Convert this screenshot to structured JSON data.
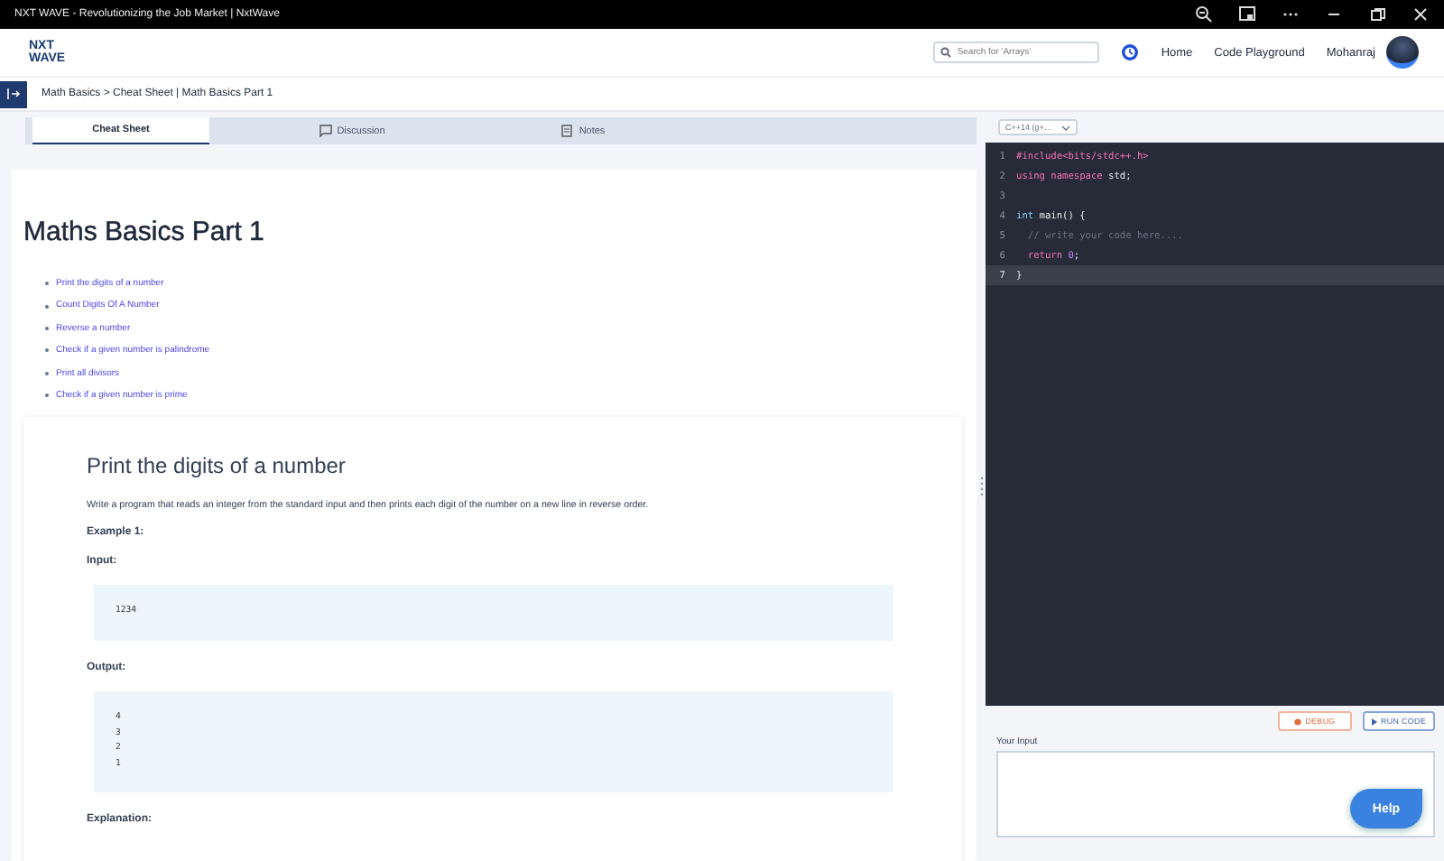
{
  "window": {
    "title": "NXT WAVE - Revolutionizing the Job Market | NxtWave"
  },
  "header": {
    "logo_lines": [
      "NXT",
      "WAVE"
    ],
    "search": {
      "placeholder": "Search for 'Arrays'"
    },
    "nav": [
      "Home",
      "Code Playground"
    ],
    "user_name": "Mohanraj"
  },
  "breadcrumb": "Math Basics > Cheat Sheet | Math Basics Part 1",
  "tabs": [
    {
      "label": "Cheat Sheet",
      "selected": true,
      "kind": "plain"
    },
    {
      "label": "Discussion",
      "selected": false,
      "kind": "chat"
    },
    {
      "label": "Notes",
      "selected": false,
      "kind": "notes"
    }
  ],
  "article": {
    "title": "Maths Basics Part 1",
    "toc": [
      "Print the digits of a number",
      "Count Digits Of A Number",
      "Reverse a number",
      "Check if a given number is palindrome",
      "Print all divisors",
      "Check if a given number is prime"
    ],
    "section": {
      "heading": "Print the digits of a number",
      "blocks": [
        {
          "kind": "paragraph",
          "text": "Write a program that reads an integer from the standard input and then prints each digit of the number on a new line in reverse order."
        },
        {
          "kind": "label",
          "text": "Example 1:"
        },
        {
          "kind": "label",
          "text": "Input:"
        },
        {
          "kind": "code",
          "lines": [
            "1234"
          ]
        },
        {
          "kind": "label",
          "text": "Output:"
        },
        {
          "kind": "code",
          "lines": [
            "4",
            "3",
            "2",
            "1"
          ]
        },
        {
          "kind": "label",
          "text": "Explanation:"
        }
      ]
    }
  },
  "editor": {
    "language": "C++14 (g+…",
    "lines": [
      {
        "number": "1",
        "selected": false,
        "tokens": [
          {
            "text": "#include<bits/stdc++.h>",
            "kind": "keyword"
          }
        ]
      },
      {
        "number": "2",
        "selected": false,
        "tokens": [
          {
            "text": "using namespace ",
            "kind": "keyword"
          },
          {
            "text": "std;",
            "kind": "plain"
          }
        ]
      },
      {
        "number": "3",
        "selected": false
      },
      {
        "number": "4",
        "selected": false,
        "tokens": [
          {
            "text": "int ",
            "kind": "type"
          },
          {
            "text": "main() {",
            "kind": "plain"
          }
        ]
      },
      {
        "number": "5",
        "selected": false,
        "tokens": [
          {
            "text": "  // write your code here....",
            "kind": "comment"
          }
        ]
      },
      {
        "number": "6",
        "selected": false,
        "tokens": [
          {
            "text": "  return ",
            "kind": "keyword"
          },
          {
            "text": "0",
            "kind": "number"
          },
          {
            "text": ";",
            "kind": "plain"
          }
        ]
      },
      {
        "number": "7",
        "selected": true,
        "tokens": [
          {
            "text": "}",
            "kind": "plain"
          }
        ]
      }
    ],
    "buttons": [
      {
        "label": "DEBUG",
        "kind": "debug"
      },
      {
        "label": "RUN CODE",
        "kind": "run"
      }
    ],
    "input_label": "Your Input",
    "help": "Help"
  }
}
